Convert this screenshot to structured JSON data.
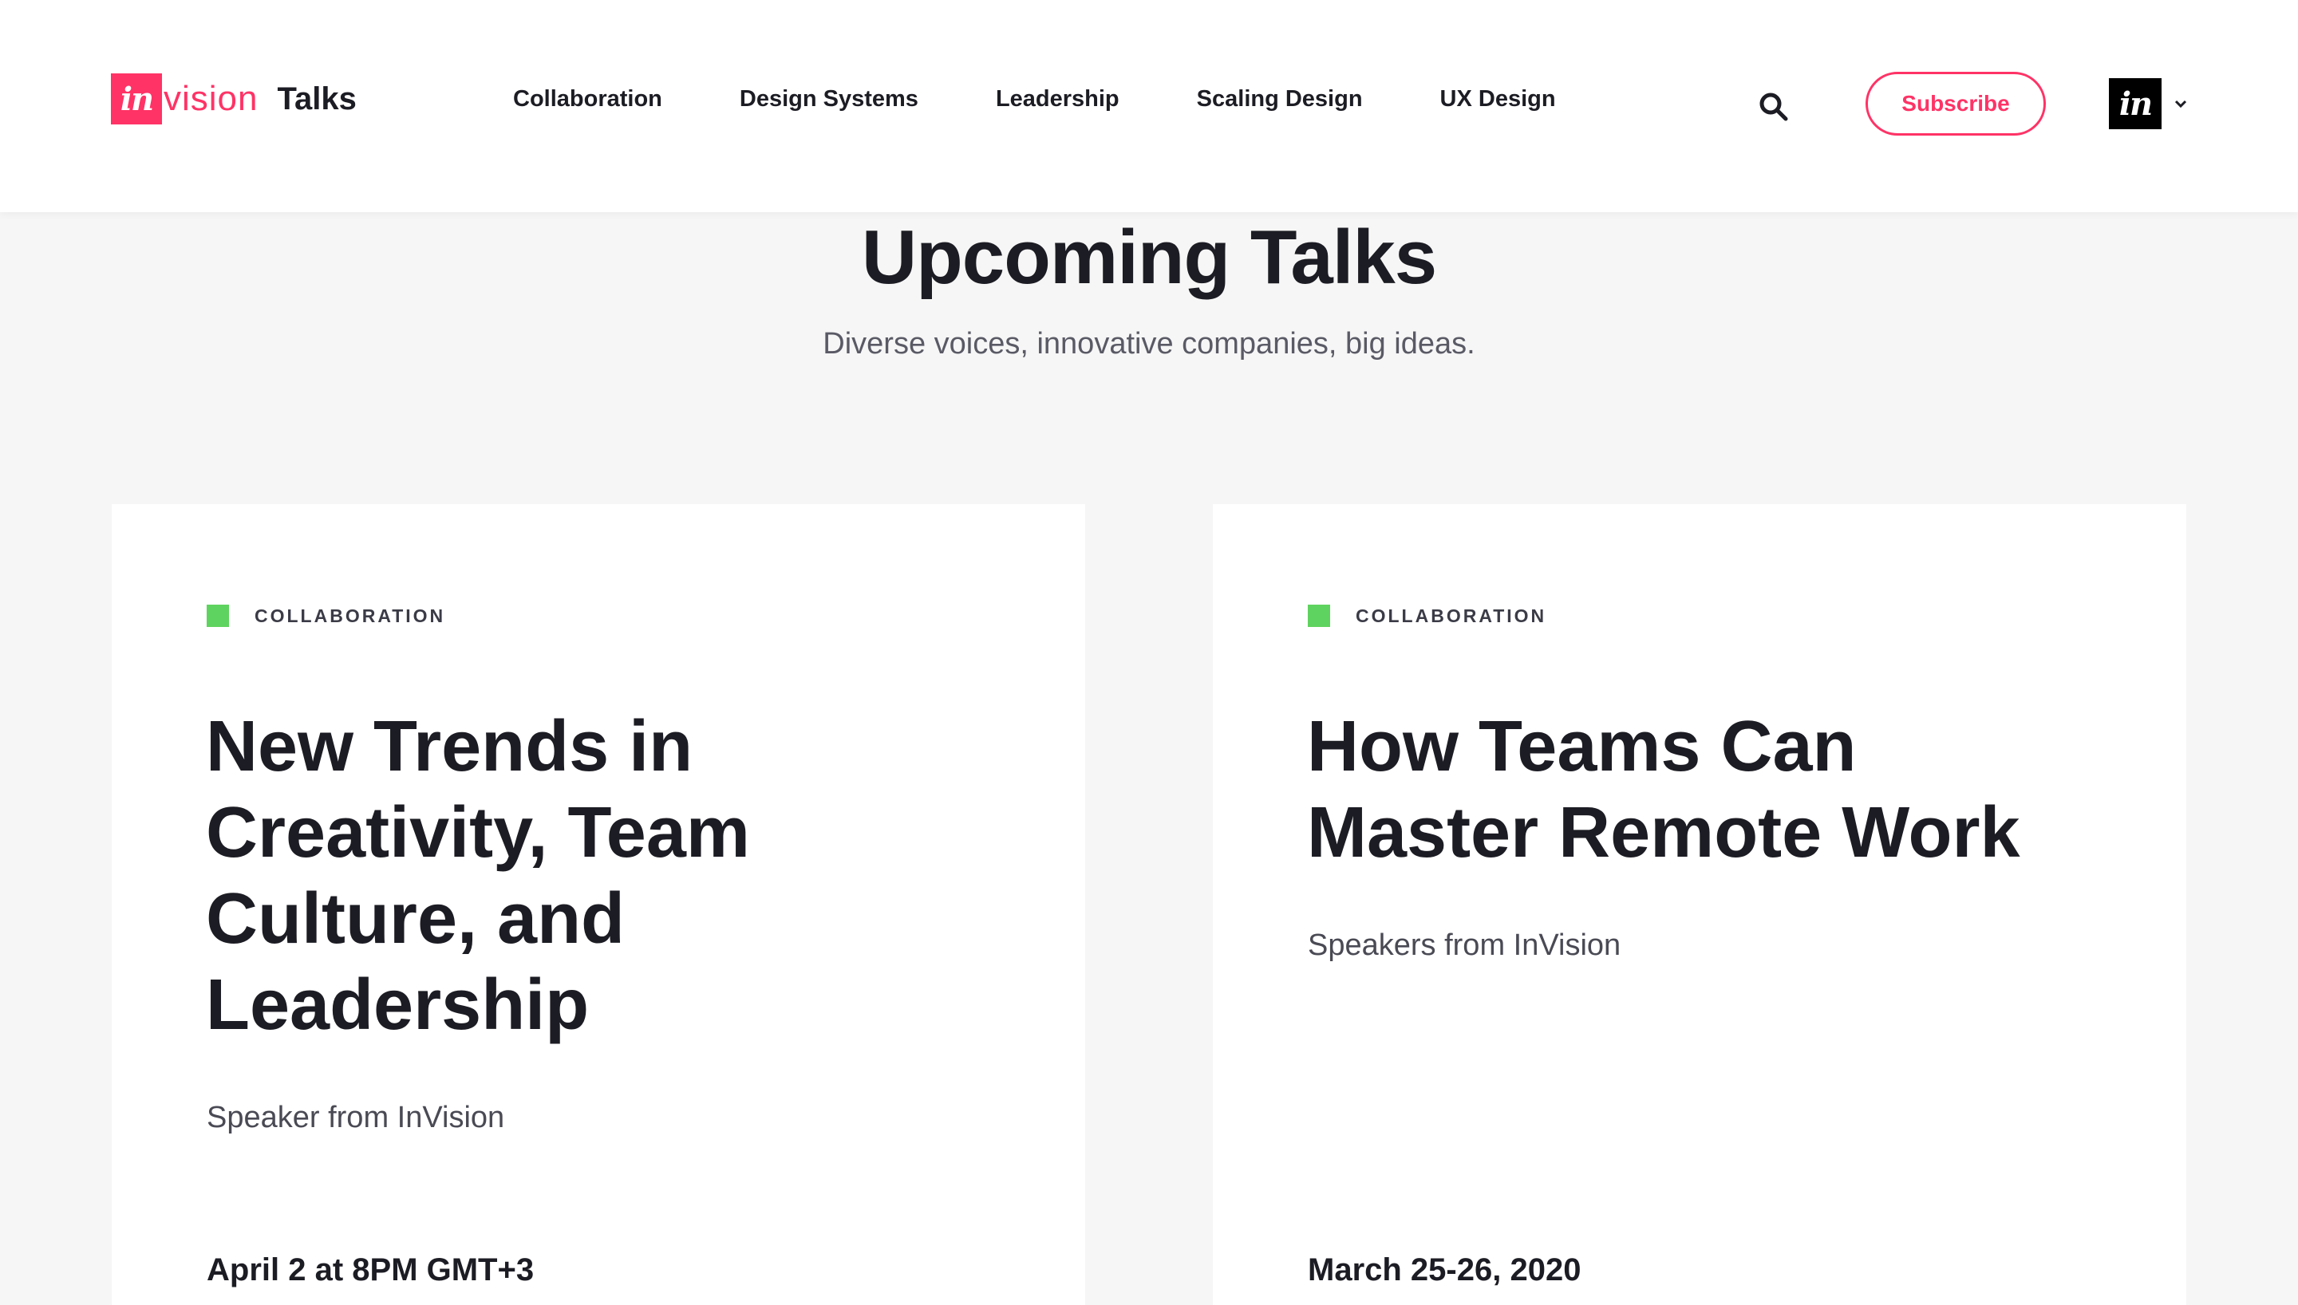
{
  "header": {
    "logo_mark": "in",
    "logo_word": "vision",
    "logo_product": "Talks",
    "nav": [
      {
        "label": "Collaboration"
      },
      {
        "label": "Design Systems"
      },
      {
        "label": "Leadership"
      },
      {
        "label": "Scaling Design"
      },
      {
        "label": "UX Design"
      }
    ],
    "search_icon": "search-icon",
    "subscribe_label": "Subscribe",
    "account_mark": "in",
    "account_caret_icon": "chevron-down-icon"
  },
  "hero": {
    "title": "Upcoming Talks",
    "subtitle": "Diverse voices, innovative companies, big ideas."
  },
  "cards": [
    {
      "tag": "COLLABORATION",
      "title": "New Trends in Creativity, Team Culture, and Leadership",
      "speaker": "Speaker from InVision",
      "date": "April 2 at 8PM GMT+3"
    },
    {
      "tag": "COLLABORATION",
      "title": "How Teams Can Master Remote Work",
      "speaker": "Speakers from InVision",
      "date": "March 25-26, 2020"
    }
  ],
  "colors": {
    "brand": "#ff3366",
    "tag_collaboration": "#5fd35f",
    "text": "#1c1c24",
    "background": "#f6f6f6"
  }
}
